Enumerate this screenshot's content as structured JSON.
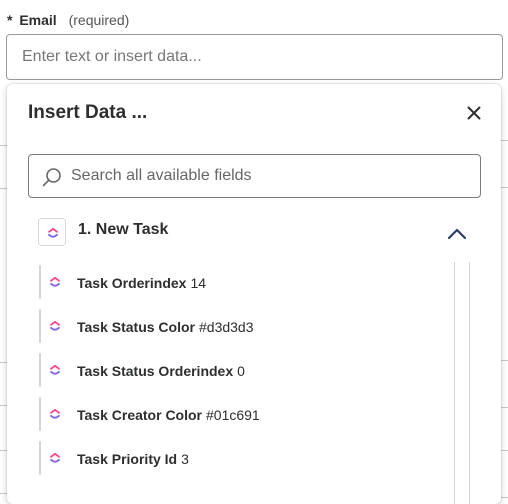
{
  "field": {
    "required_marker": "*",
    "label": "Email",
    "hint": "(required)",
    "placeholder": "Enter text or insert data..."
  },
  "panel": {
    "title": "Insert Data ...",
    "close_icon": "close-icon",
    "search": {
      "placeholder": "Search all available fields",
      "icon": "search-icon"
    },
    "group": {
      "title": "1. New Task",
      "icon": "clickup-icon",
      "expanded": true,
      "chevron_icon": "chevron-up-icon"
    },
    "items": [
      {
        "label": "Task Orderindex",
        "value": "14"
      },
      {
        "label": "Task Status Color",
        "value": "#d3d3d3"
      },
      {
        "label": "Task Status Orderindex",
        "value": "0"
      },
      {
        "label": "Task Creator Color",
        "value": "#01c691"
      },
      {
        "label": "Task Priority Id",
        "value": "3"
      }
    ]
  },
  "colors": {
    "text": "#2d2e2e",
    "chevron": "#2d3d6b",
    "clickup_purple": "#7b68ee",
    "clickup_pink": "#fd3e8a",
    "clickup_blue": "#49ccf9"
  }
}
